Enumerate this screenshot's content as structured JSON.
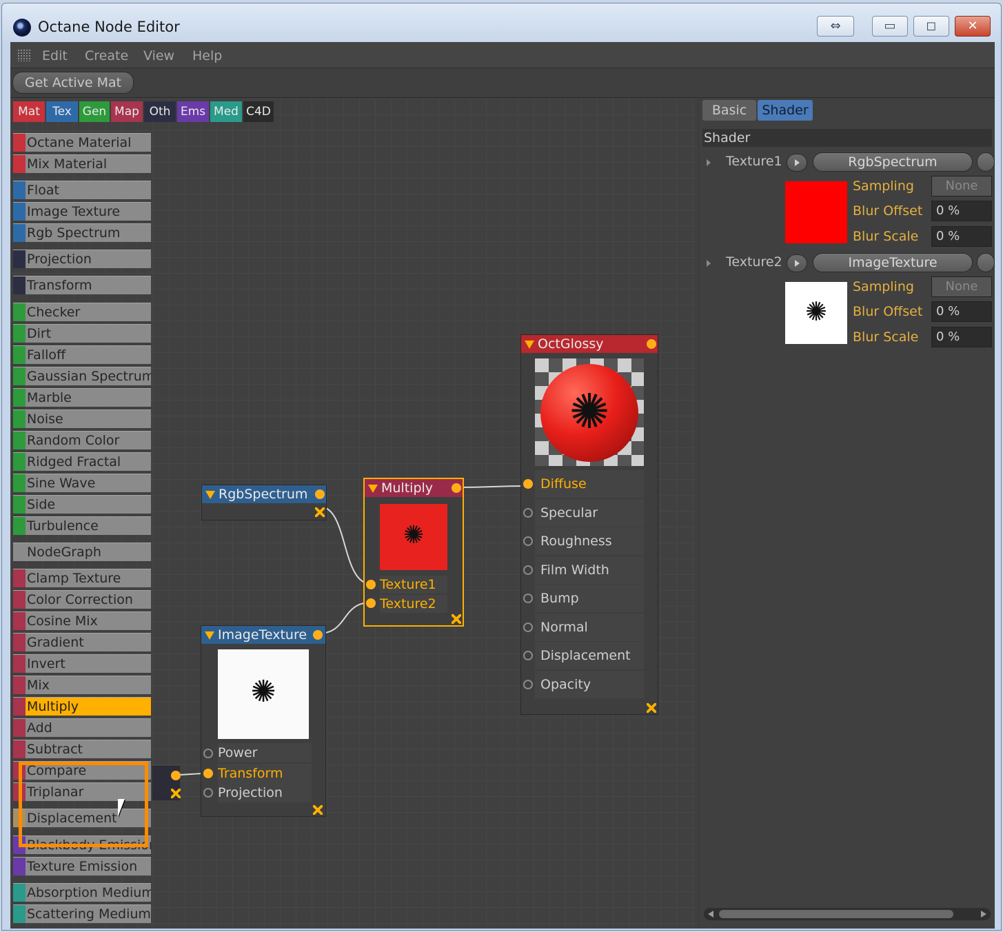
{
  "window": {
    "title": "Octane Node Editor"
  },
  "menu": {
    "items": [
      "Edit",
      "Create",
      "View",
      "Help"
    ]
  },
  "toolbar": {
    "get_active_mat": "Get Active Mat"
  },
  "categories": [
    {
      "label": "Mat",
      "color": "#c8323c"
    },
    {
      "label": "Tex",
      "color": "#2f6aa8"
    },
    {
      "label": "Gen",
      "color": "#2e9a3c"
    },
    {
      "label": "Map",
      "color": "#a8344e"
    },
    {
      "label": "Oth",
      "color": "#2c2f44"
    },
    {
      "label": "Ems",
      "color": "#6a3aa8"
    },
    {
      "label": "Med",
      "color": "#2a9a8a"
    },
    {
      "label": "C4D",
      "color": "#2a2a2a"
    }
  ],
  "library": {
    "items": [
      "Octane Material",
      "Mix Material",
      "Float",
      "Image Texture",
      "Rgb Spectrum",
      "Projection",
      "Transform",
      "Checker",
      "Dirt",
      "Falloff",
      "Gaussian Spectrum",
      "Marble",
      "Noise",
      "Random Color",
      "Ridged Fractal",
      "Sine Wave",
      "Side",
      "Turbulence",
      "NodeGraph",
      "Clamp Texture",
      "Color Correction",
      "Cosine Mix",
      "Gradient",
      "Invert",
      "Mix",
      "Multiply",
      "Add",
      "Subtract",
      "Compare",
      "Triplanar",
      "Displacement",
      "Blackbody Emission",
      "Texture Emission",
      "Absorption Medium",
      "Scattering Medium"
    ],
    "active": "Multiply"
  },
  "nodes": {
    "rgb_spectrum": {
      "title": "RgbSpectrum"
    },
    "image_texture": {
      "title": "ImageTexture",
      "inputs": [
        "Power",
        "Transform",
        "Projection"
      ]
    },
    "multiply": {
      "title": "Multiply",
      "inputs": [
        "Texture1",
        "Texture2"
      ]
    },
    "oct_glossy": {
      "title": "OctGlossy",
      "inputs": [
        "Diffuse",
        "Specular",
        "Roughness",
        "Film Width",
        "Bump",
        "Normal",
        "Displacement",
        "Opacity"
      ]
    }
  },
  "attributes": {
    "tabs": [
      "Basic",
      "Shader"
    ],
    "active_tab": "Shader",
    "section": "Shader",
    "texture1": {
      "label": "Texture1",
      "value": "RgbSpectrum",
      "sampling_label": "Sampling",
      "sampling": "None",
      "blur_offset_label": "Blur Offset",
      "blur_offset": "0 %",
      "blur_scale_label": "Blur Scale",
      "blur_scale": "0 %",
      "swatch": "#ff0000"
    },
    "texture2": {
      "label": "Texture2",
      "value": "ImageTexture",
      "sampling_label": "Sampling",
      "sampling": "None",
      "blur_offset_label": "Blur Offset",
      "blur_offset": "0 %",
      "blur_scale_label": "Blur Scale",
      "blur_scale": "0 %",
      "swatch": "#ffffff"
    }
  },
  "colors": {
    "accent": "#ffb000",
    "node_tex_head": "#2f5f8f",
    "node_map_head": "#9a2a4a",
    "node_mat_head": "#b8282e"
  },
  "icons": {
    "octane_logo": "octane-logo-icon",
    "resize": "resize-icon"
  }
}
